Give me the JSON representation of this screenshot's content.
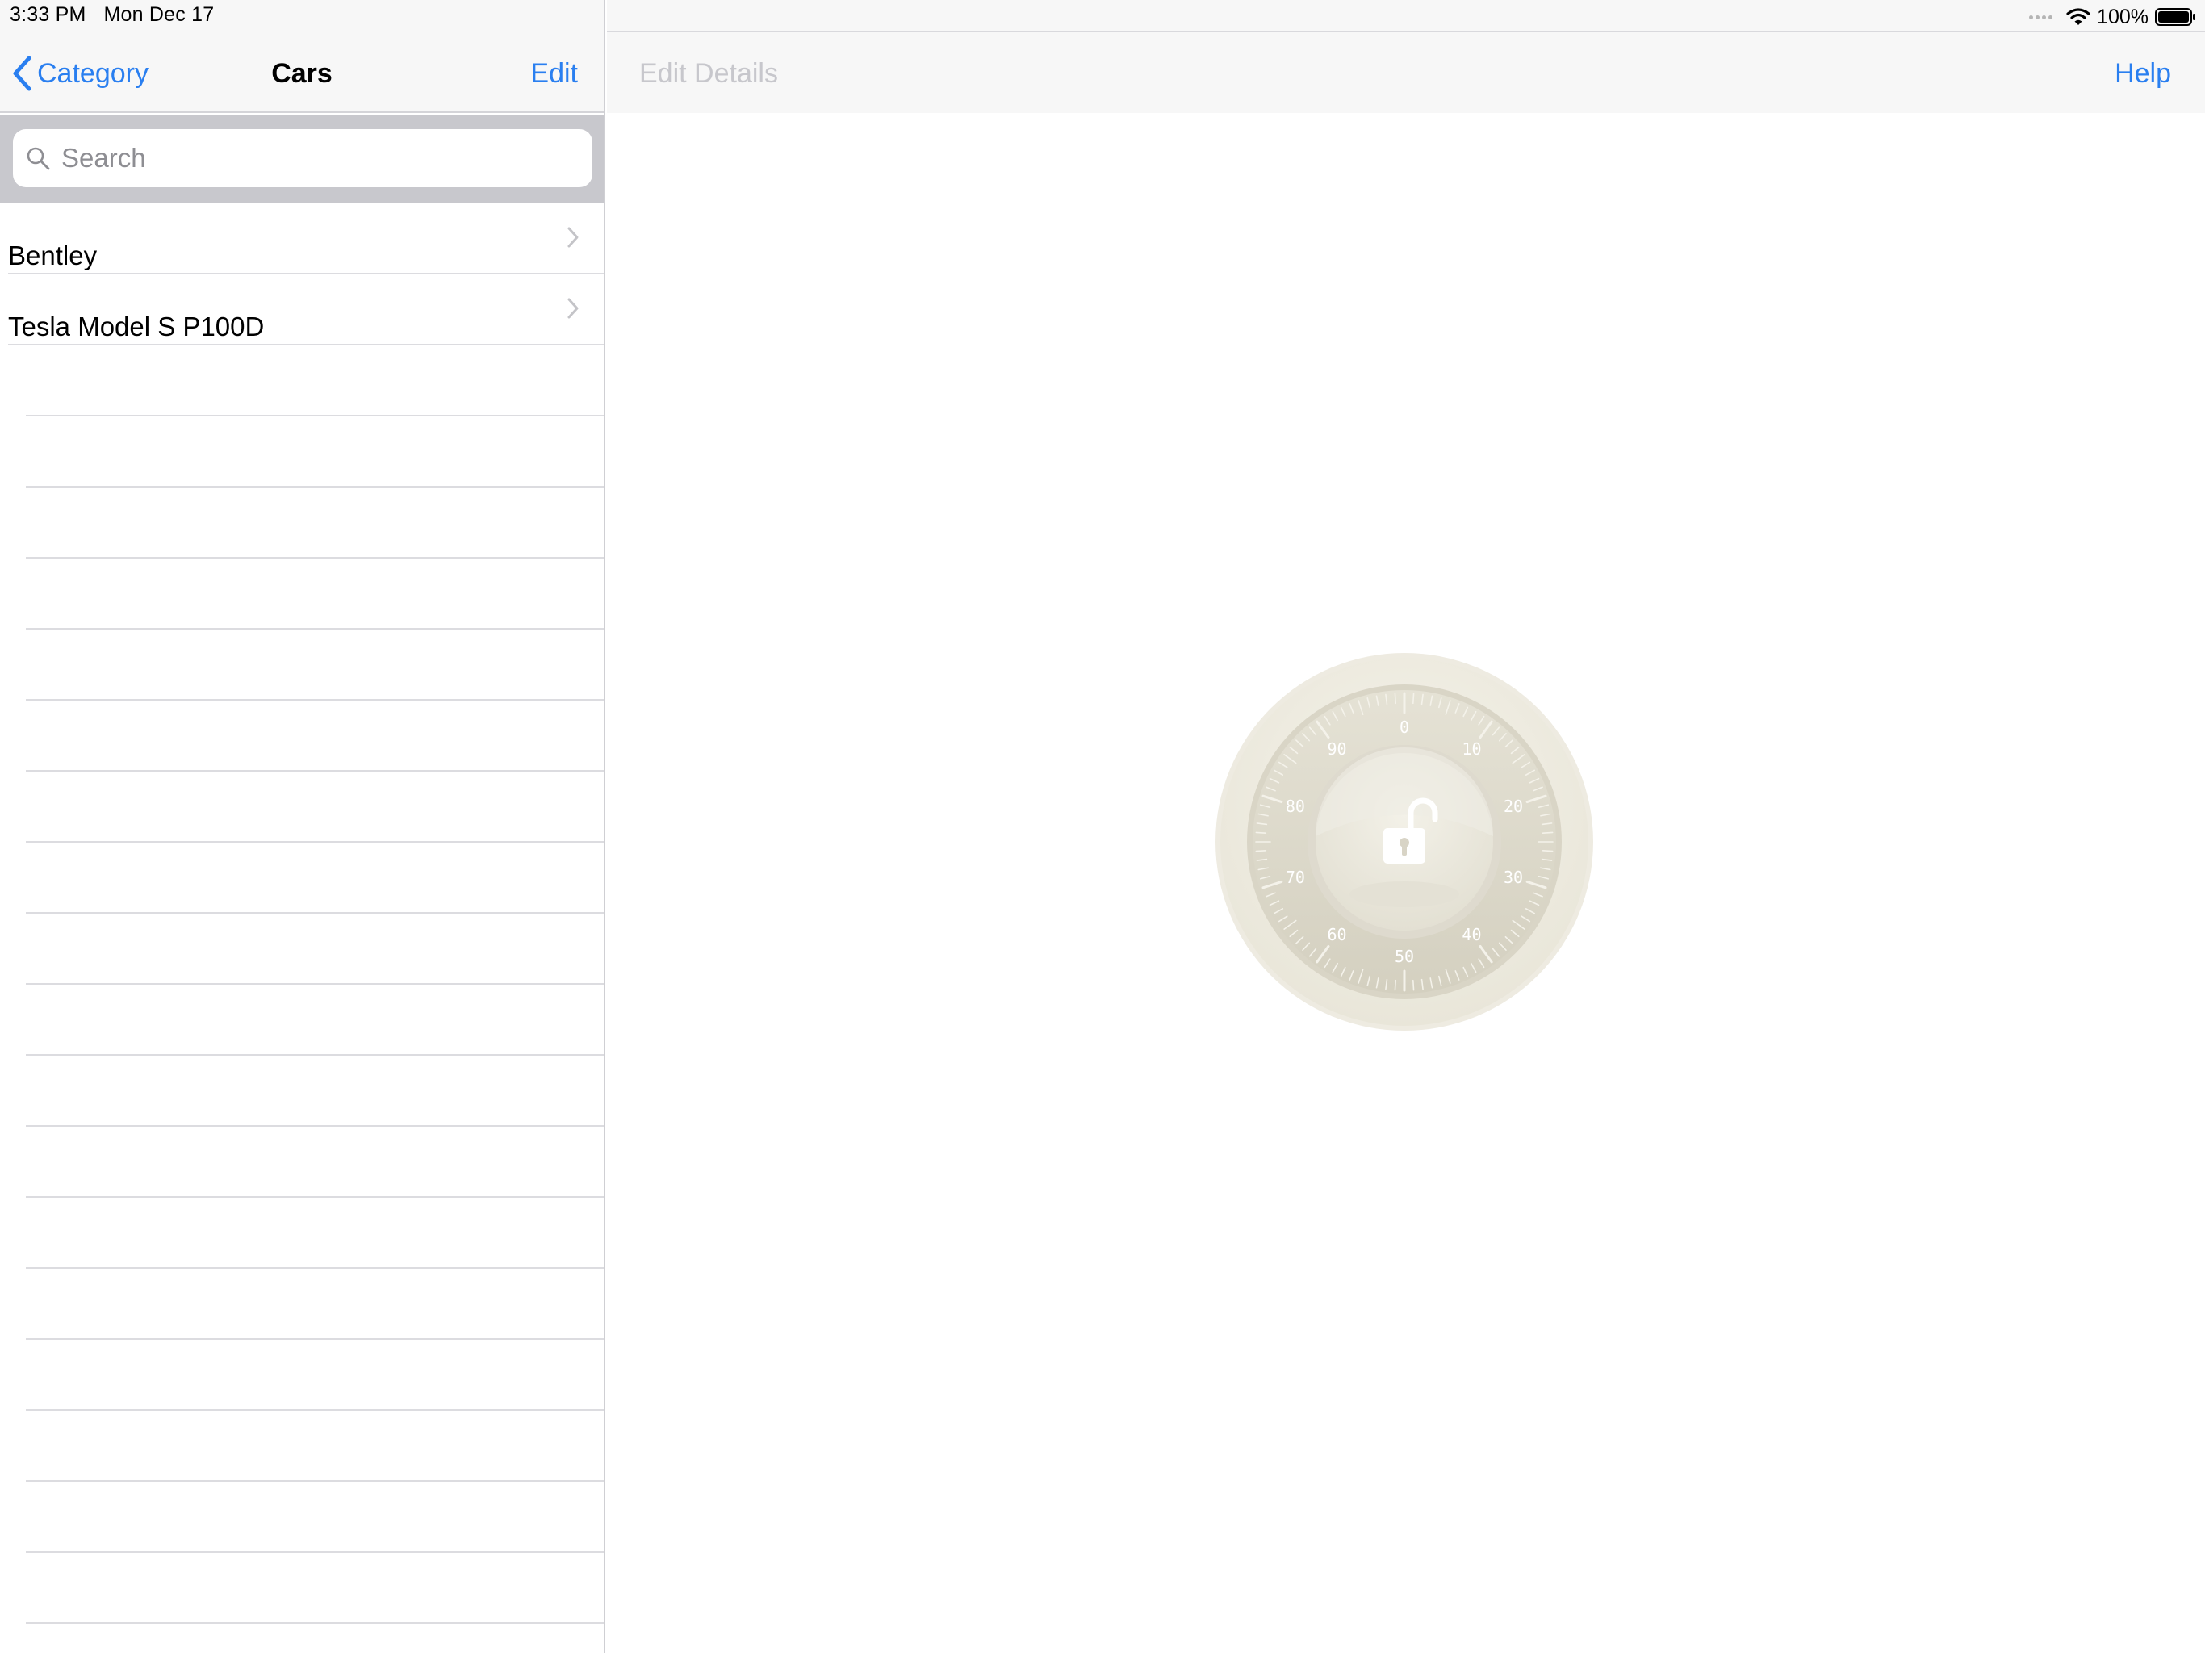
{
  "status_bar": {
    "time": "3:33 PM",
    "date": "Mon Dec 17",
    "battery": "100%"
  },
  "master": {
    "back_label": "Category",
    "title": "Cars",
    "edit_label": "Edit",
    "search_placeholder": "Search",
    "items": [
      {
        "label": "Bentley"
      },
      {
        "label": "Tesla Model S P100D"
      }
    ]
  },
  "detail": {
    "edit_details_label": "Edit Details",
    "help_label": "Help",
    "dial_numbers": [
      "0",
      "10",
      "20",
      "30",
      "40",
      "50",
      "60",
      "70",
      "80",
      "90"
    ]
  },
  "colors": {
    "accent": "#2a7ff0",
    "disabled": "#c7c7cc",
    "bar_background": "#f7f7f7",
    "search_background": "#c8c8cd"
  },
  "icons": {
    "back": "chevron-left-icon",
    "search": "magnifying-glass-icon",
    "row_disclosure": "chevron-right-icon",
    "wifi": "wifi-icon",
    "battery": "battery-icon",
    "lock": "unlocked-padlock-icon"
  }
}
